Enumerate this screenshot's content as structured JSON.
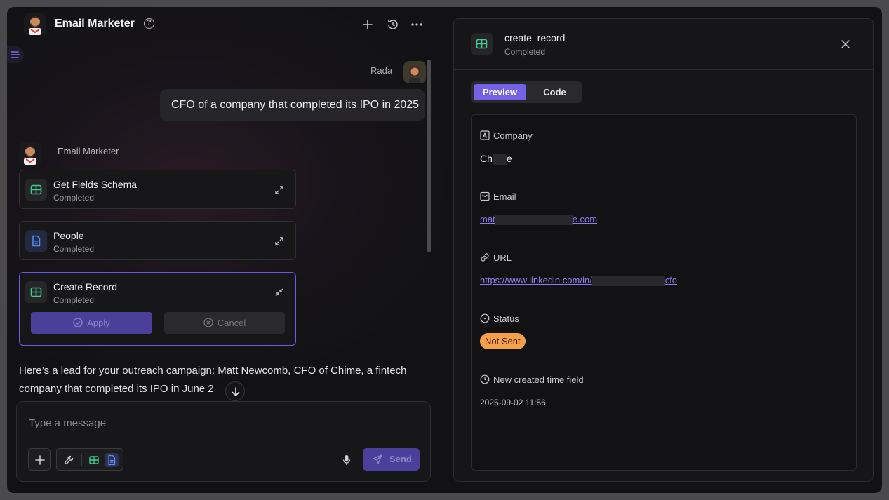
{
  "chat": {
    "title": "Email Marketer",
    "user": {
      "name": "Rada",
      "message": "CFO of a company that completed its IPO in 2025"
    },
    "agent": {
      "name": "Email Marketer"
    },
    "tool_calls": [
      {
        "title": "Get Fields Schema",
        "status": "Completed",
        "icon": "table-icon"
      },
      {
        "title": "People",
        "status": "Completed",
        "icon": "document-icon"
      },
      {
        "title": "Create Record",
        "status": "Completed",
        "icon": "table-icon"
      }
    ],
    "actions": {
      "apply": "Apply",
      "cancel": "Cancel"
    },
    "agent_message": "Here’s a lead for your outreach campaign: Matt Newcomb, CFO of Chime, a fintech company that completed its IPO in June 2",
    "composer": {
      "placeholder": "Type a message",
      "send": "Send"
    }
  },
  "panel": {
    "title": "create_record",
    "status": "Completed",
    "tabs": {
      "preview": "Preview",
      "code": "Code"
    },
    "fields": {
      "company": {
        "label": "Company",
        "value_start": "Ch",
        "value_end": "e"
      },
      "email": {
        "label": "Email",
        "value_start": "mat",
        "value_end": "e.com"
      },
      "url": {
        "label": "URL",
        "value_start": "https://www.linkedin.com/in/",
        "value_end": "cfo"
      },
      "status": {
        "label": "Status",
        "value": "Not Sent"
      },
      "created": {
        "label": "New created time field",
        "value": "2025-09-02 11:56"
      }
    }
  },
  "colors": {
    "accent": "#7561e6",
    "accent_dim": "#4c3f9a",
    "status_badge": "#f5a04a",
    "table_icon_green": "#3ecf8e",
    "document_icon_blue": "#5b8cf5"
  }
}
